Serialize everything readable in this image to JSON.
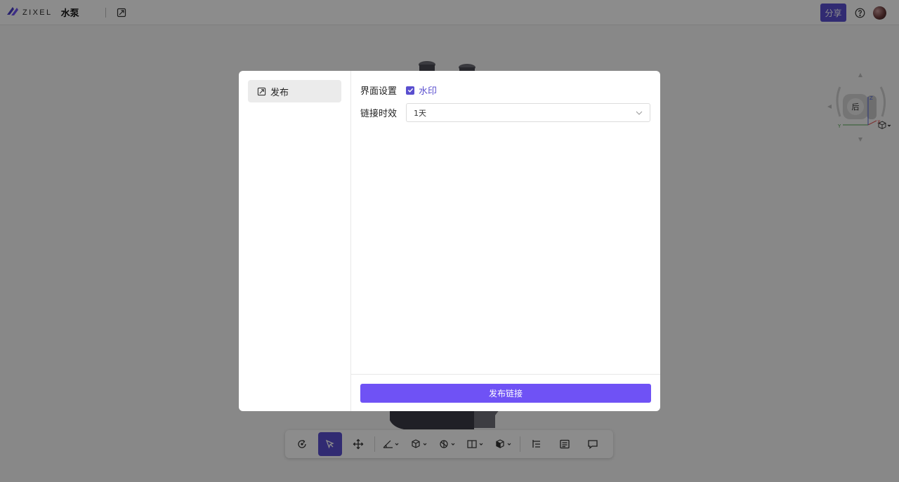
{
  "app": {
    "logo_text": "ZIXEL",
    "doc_title": "水泵",
    "share_label": "分享"
  },
  "viewcube": {
    "face_label": "后",
    "axis_x": "X",
    "axis_y": "Y",
    "axis_z": "Z"
  },
  "dialog": {
    "sidebar": {
      "items": [
        {
          "label": "发布",
          "icon": "publish-icon"
        }
      ]
    },
    "form": {
      "ui_settings_label": "界面设置",
      "watermark_label": "水印",
      "watermark_checked": true,
      "link_expiry_label": "链接时效",
      "link_expiry_value": "1天"
    },
    "publish_button_label": "发布链接"
  },
  "colors": {
    "accent": "#5a4fcf",
    "primary_button": "#6f52f5"
  },
  "toolbar": {
    "icons": [
      "rotate-icon",
      "select-cursor-icon",
      "move-icon",
      "measure-icon",
      "section-icon",
      "explode-icon",
      "view-split-icon",
      "render-mode-icon",
      "model-tree-icon",
      "properties-icon",
      "comment-icon"
    ]
  }
}
